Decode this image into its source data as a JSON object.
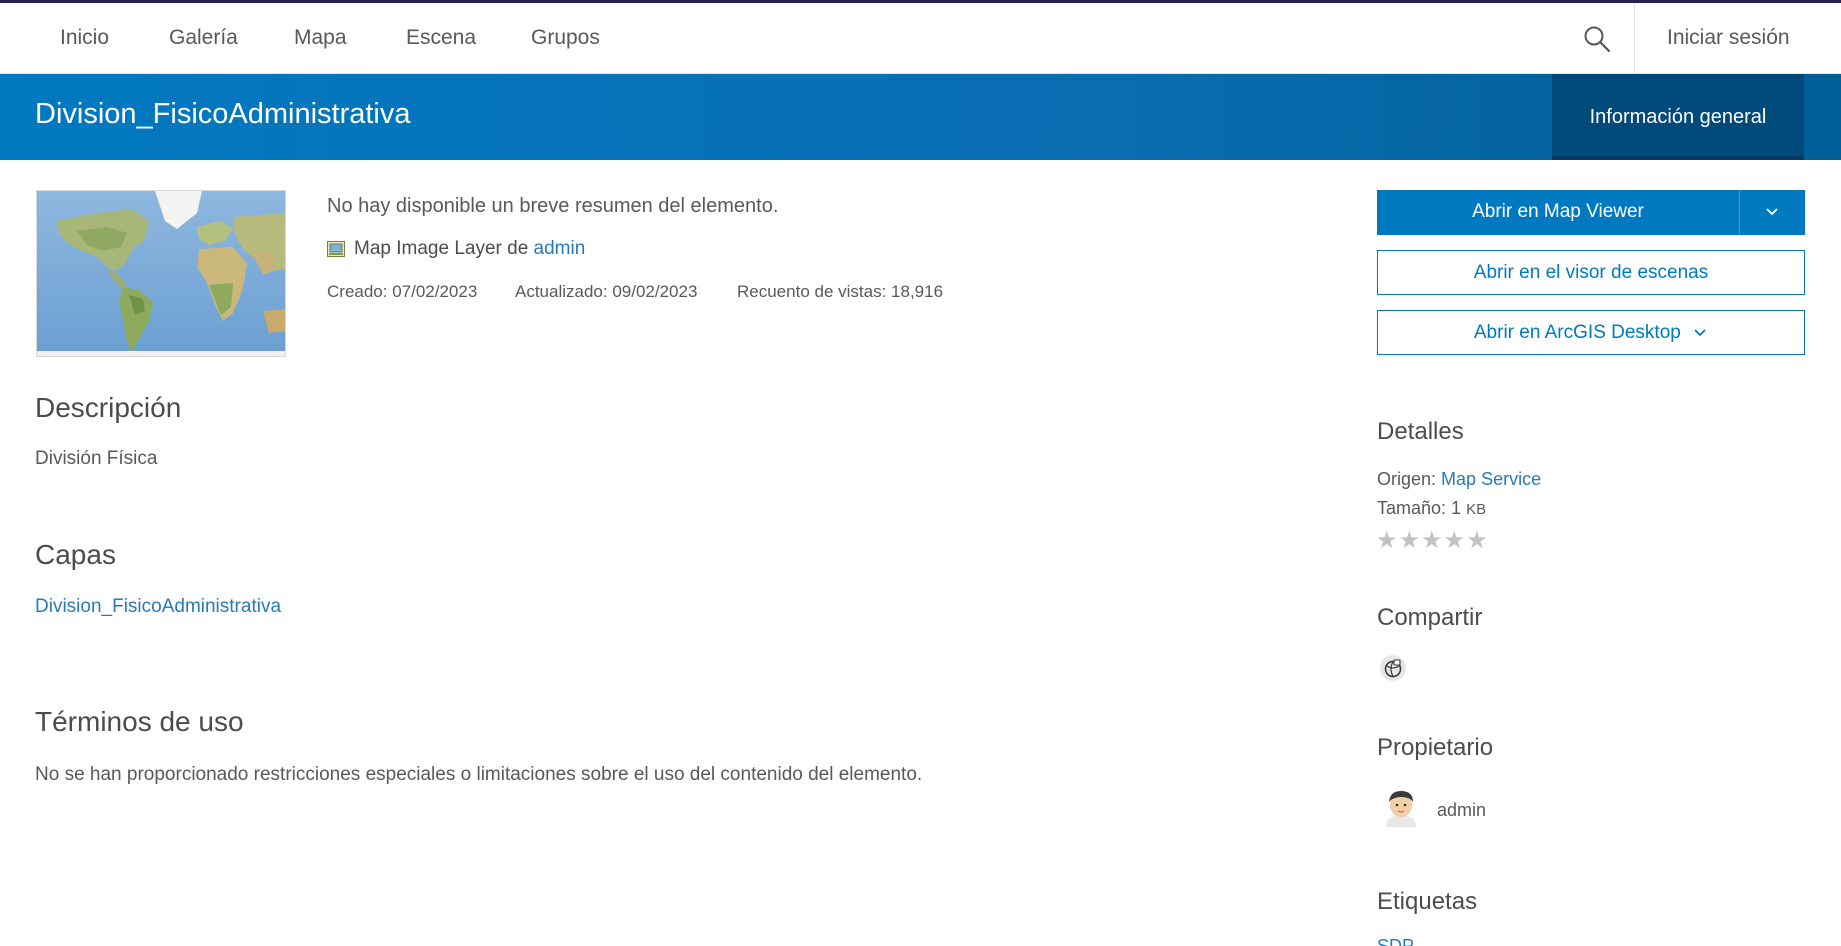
{
  "nav": {
    "items": [
      "Inicio",
      "Galería",
      "Mapa",
      "Escena",
      "Grupos"
    ],
    "signin": "Iniciar sesión"
  },
  "header": {
    "title": "Division_FisicoAdministrativa",
    "tab": "Información general"
  },
  "summary": {
    "text": "No hay disponible un breve resumen del elemento.",
    "type_label": "Map Image Layer de",
    "owner_link": "admin",
    "created": "Creado: 07/02/2023",
    "updated": "Actualizado: 09/02/2023",
    "views": "Recuento de vistas: 18,916"
  },
  "description": {
    "heading": "Descripción",
    "text": "División Física"
  },
  "layers": {
    "heading": "Capas",
    "link": "Division_FisicoAdministrativa"
  },
  "terms": {
    "heading": "Términos de uso",
    "text": "No se han proporcionado restricciones especiales o limitaciones sobre el uso del contenido del elemento."
  },
  "actions": {
    "open_map_viewer": "Abrir en Map Viewer",
    "open_scene_viewer": "Abrir en el visor de escenas",
    "open_arcgis_desktop": "Abrir en ArcGIS Desktop"
  },
  "details": {
    "heading": "Detalles",
    "source_label": "Origen:",
    "source_link": "Map Service",
    "size_label": "Tamaño: 1",
    "size_unit": "KB",
    "rating_stars": "★★★★★",
    "rating_value": 0
  },
  "share": {
    "heading": "Compartir",
    "icon": "globe-lock-icon"
  },
  "owner": {
    "heading": "Propietario",
    "name": "admin"
  },
  "tags": {
    "heading": "Etiquetas",
    "first": "SDP"
  },
  "colors": {
    "brand_blue": "#0079c1",
    "active_tab": "#004a7c",
    "link": "#2a7ab8"
  }
}
